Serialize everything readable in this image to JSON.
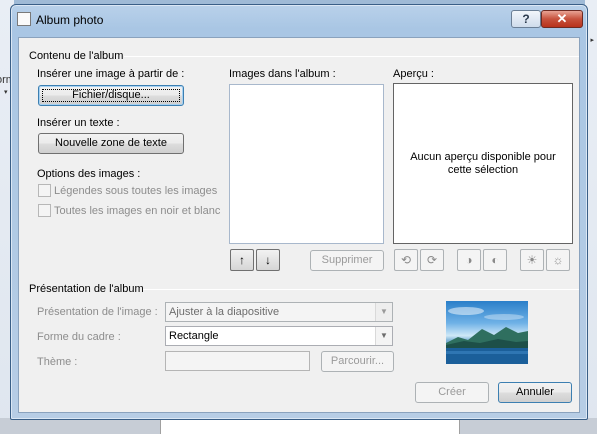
{
  "background": {
    "left_label": "orm",
    "left_arrow": "▾",
    "right_arrow": "▸"
  },
  "window": {
    "title": "Album photo",
    "help_label": "?",
    "close_label": "✕"
  },
  "album_content": {
    "legend": "Contenu de l'album",
    "insert_image_label": "Insérer une image à partir de :",
    "file_disk_button": "Fichier/disque...",
    "insert_text_label": "Insérer un texte :",
    "new_textbox_button": "Nouvelle zone de texte",
    "image_options_label": "Options des images :",
    "captions_option": "Légendes sous toutes les images",
    "bw_option": "Toutes les images en noir et blanc",
    "images_in_album_label": "Images dans l'album :",
    "move_up_icon": "↑",
    "move_down_icon": "↓",
    "remove_button": "Supprimer",
    "preview_label": "Aperçu :",
    "preview_empty_text": "Aucun aperçu disponible pour cette sélection",
    "rotate_left_icon": "⟲",
    "rotate_right_icon": "⟳",
    "contrast_up_icon": "◑",
    "contrast_down_icon": "◐",
    "brightness_up_icon": "☀",
    "brightness_down_icon": "☼"
  },
  "album_layout": {
    "legend": "Présentation de l'album",
    "picture_layout_label": "Présentation de l'image :",
    "picture_layout_value": "Ajuster à la diapositive",
    "frame_shape_label": "Forme du cadre :",
    "frame_shape_value": "Rectangle",
    "theme_label": "Thème :",
    "theme_value": "",
    "browse_button": "Parcourir...",
    "dropdown_arrow": "▼"
  },
  "footer": {
    "create_button": "Créer",
    "cancel_button": "Annuler"
  },
  "colors": {
    "title_bar": "#a9c6e4",
    "close_button": "#c7523d",
    "dialog_bg": "#f0f0f0",
    "focus_border": "#3c7fb1"
  }
}
